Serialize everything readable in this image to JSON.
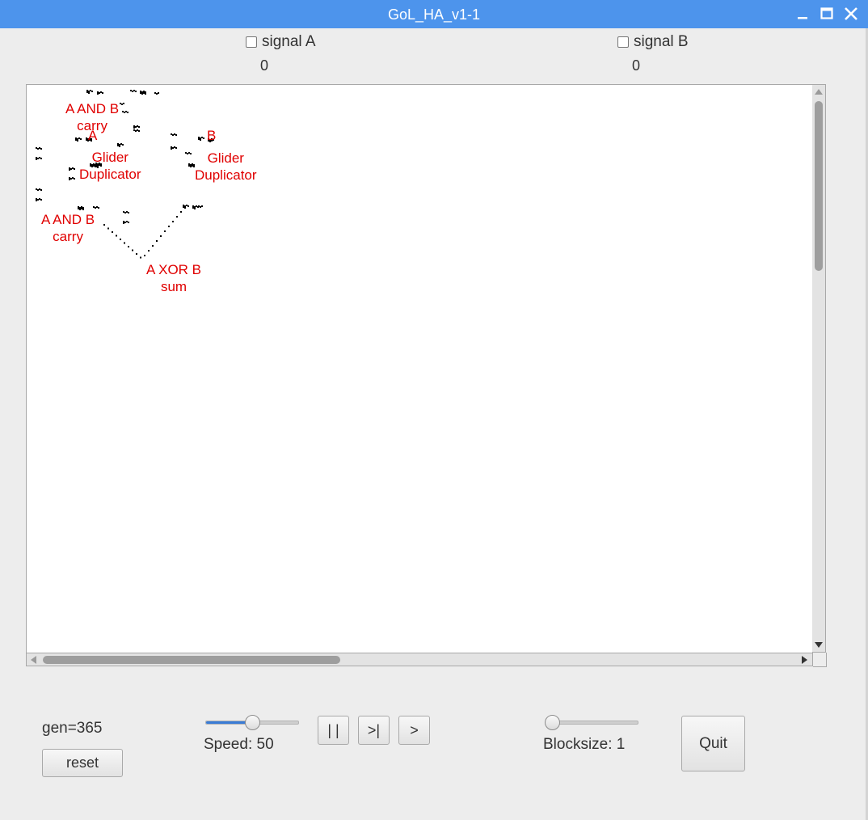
{
  "window": {
    "title": "GoL_HA_v1-1"
  },
  "signals": [
    {
      "label": "signal A",
      "checked": false,
      "count": "0"
    },
    {
      "label": "signal B",
      "checked": false,
      "count": "0"
    }
  ],
  "canvas_labels": [
    {
      "line1": "A AND B",
      "line2": "carry"
    },
    {
      "line1": "A",
      "line2": ""
    },
    {
      "line1": "Glider",
      "line2": "Duplicator"
    },
    {
      "line1": "B",
      "line2": ""
    },
    {
      "line1": "Glider",
      "line2": "Duplicator"
    },
    {
      "line1": "A AND B",
      "line2": "carry"
    },
    {
      "line1": "A XOR B",
      "line2": "sum"
    }
  ],
  "controls": {
    "gen_text": "gen=365",
    "reset_label": "reset",
    "speed_text": "Speed: 50",
    "speed_value": 50,
    "pause_label": "| |",
    "step_label": ">|",
    "play_label": ">",
    "blocksize_text": "Blocksize: 1",
    "blocksize_value": 1,
    "quit_label": "Quit"
  },
  "colors": {
    "titlebar": "#4d94ec",
    "annotation": "#e00000",
    "slider_fill": "#3a7cd6"
  }
}
